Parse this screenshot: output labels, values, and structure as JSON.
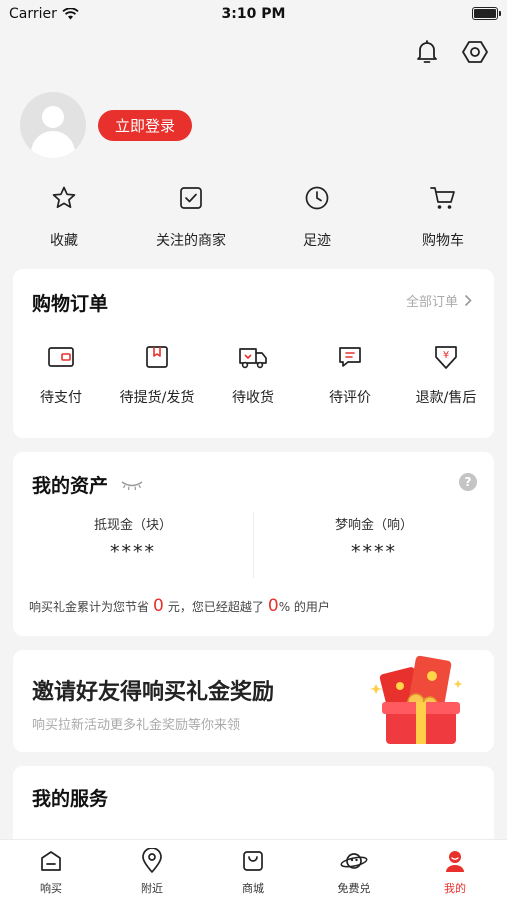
{
  "status_bar": {
    "carrier": "Carrier",
    "time": "3:10 PM"
  },
  "header": {
    "icons": [
      "bell-icon",
      "settings-hexagon-icon"
    ]
  },
  "profile": {
    "login_label": "立即登录"
  },
  "quick_links": [
    {
      "label": "收藏",
      "icon": "star-icon"
    },
    {
      "label": "关注的商家",
      "icon": "checkbox-icon"
    },
    {
      "label": "足迹",
      "icon": "clock-icon"
    },
    {
      "label": "购物车",
      "icon": "cart-icon"
    }
  ],
  "orders": {
    "title": "购物订单",
    "all_label": "全部订单",
    "items": [
      {
        "label": "待支付",
        "icon": "wallet-icon"
      },
      {
        "label": "待提货/发货",
        "icon": "package-icon"
      },
      {
        "label": "待收货",
        "icon": "truck-icon"
      },
      {
        "label": "待评价",
        "icon": "comment-icon"
      },
      {
        "label": "退款/售后",
        "icon": "refund-icon"
      }
    ]
  },
  "assets": {
    "title": "我的资产",
    "help_symbol": "?",
    "columns": [
      {
        "label": "抵现金（块）",
        "value": "****"
      },
      {
        "label": "梦响金（响）",
        "value": "****"
      }
    ],
    "note": {
      "prefix": "响买礼金累计为您节省",
      "saved": "0",
      "middle": "元，您已经超越了",
      "percent": "0",
      "suffix": "% 的用户"
    }
  },
  "invite": {
    "title": "邀请好友得响买礼金奖励",
    "subtitle": "响买拉新活动更多礼金奖励等你来领"
  },
  "services": {
    "title": "我的服务"
  },
  "tabbar": {
    "active_index": 4,
    "accent_color": "#e8312c",
    "items": [
      {
        "label": "响买",
        "icon": "home-icon"
      },
      {
        "label": "附近",
        "icon": "location-pin-icon"
      },
      {
        "label": "商城",
        "icon": "shopping-bag-icon"
      },
      {
        "label": "免费兑",
        "icon": "planet-icon"
      },
      {
        "label": "我的",
        "icon": "user-icon"
      }
    ]
  }
}
